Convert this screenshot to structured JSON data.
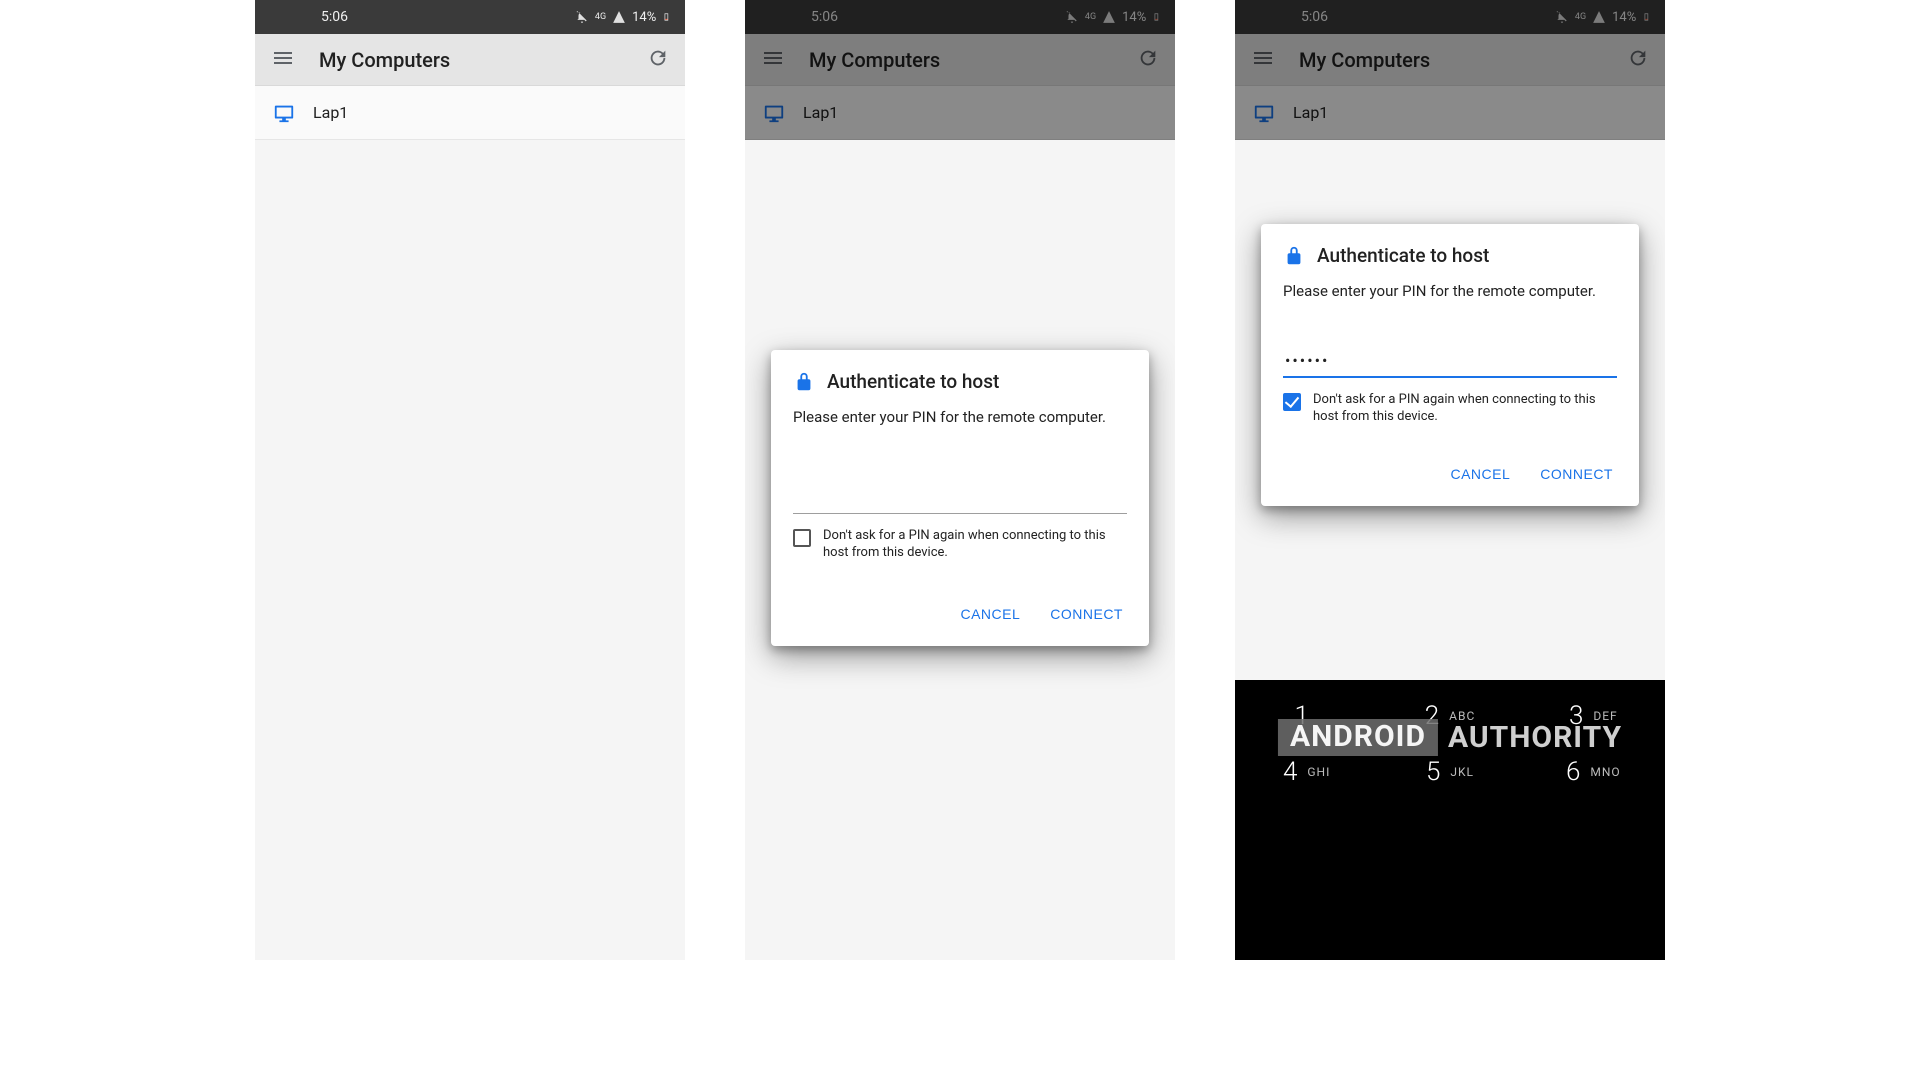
{
  "status": {
    "time": "5:06",
    "battery": "14%"
  },
  "appbar": {
    "title": "My Computers"
  },
  "computer": {
    "name": "Lap1"
  },
  "dialog": {
    "title": "Authenticate to host",
    "message": "Please enter your PIN for the remote computer.",
    "checkbox_label": "Don't ask for a PIN again when connecting to this host from this device.",
    "cancel": "CANCEL",
    "connect": "CONNECT",
    "pin_filled": "••••••"
  },
  "keypad": {
    "k1": "1",
    "k1s": "",
    "k2": "2",
    "k2s": "ABC",
    "k3": "3",
    "k3s": "DEF",
    "k4": "4",
    "k4s": "GHI",
    "k5": "5",
    "k5s": "JKL",
    "k6": "6",
    "k6s": "MNO"
  },
  "watermark": {
    "left": "ANDROID",
    "right": "AUTHORITY"
  }
}
